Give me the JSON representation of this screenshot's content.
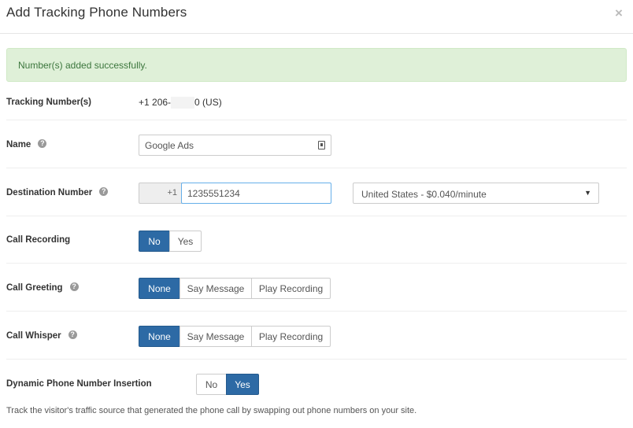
{
  "modal": {
    "title": "Add Tracking Phone Numbers",
    "close_label": "×"
  },
  "alert": {
    "text": "Number(s) added successfully."
  },
  "tracking": {
    "label": "Tracking Number(s)",
    "prefix": "+1 206-",
    "suffix": "0 (US)"
  },
  "name": {
    "label": "Name",
    "help_icon": "question-circle-icon",
    "value": "Google Ads"
  },
  "destination": {
    "label": "Destination Number",
    "help_icon": "question-circle-icon",
    "country_code": "+1",
    "value": "1235551234",
    "rate_select": "United States - $0.040/minute"
  },
  "call_recording": {
    "label": "Call Recording",
    "options": [
      "No",
      "Yes"
    ],
    "selected": "No"
  },
  "call_greeting": {
    "label": "Call Greeting",
    "help_icon": "question-circle-icon",
    "options": [
      "None",
      "Say Message",
      "Play Recording"
    ],
    "selected": "None"
  },
  "call_whisper": {
    "label": "Call Whisper",
    "help_icon": "question-circle-icon",
    "options": [
      "None",
      "Say Message",
      "Play Recording"
    ],
    "selected": "None"
  },
  "dni": {
    "label": "Dynamic Phone Number Insertion",
    "options": [
      "No",
      "Yes"
    ],
    "selected": "Yes"
  },
  "footnote": "Track the visitor's traffic source that generated the phone call by swapping out phone numbers on your site.",
  "colors": {
    "primary_button": "#2d6aa5",
    "alert_bg": "#dff0d8",
    "alert_text": "#3c763d"
  }
}
